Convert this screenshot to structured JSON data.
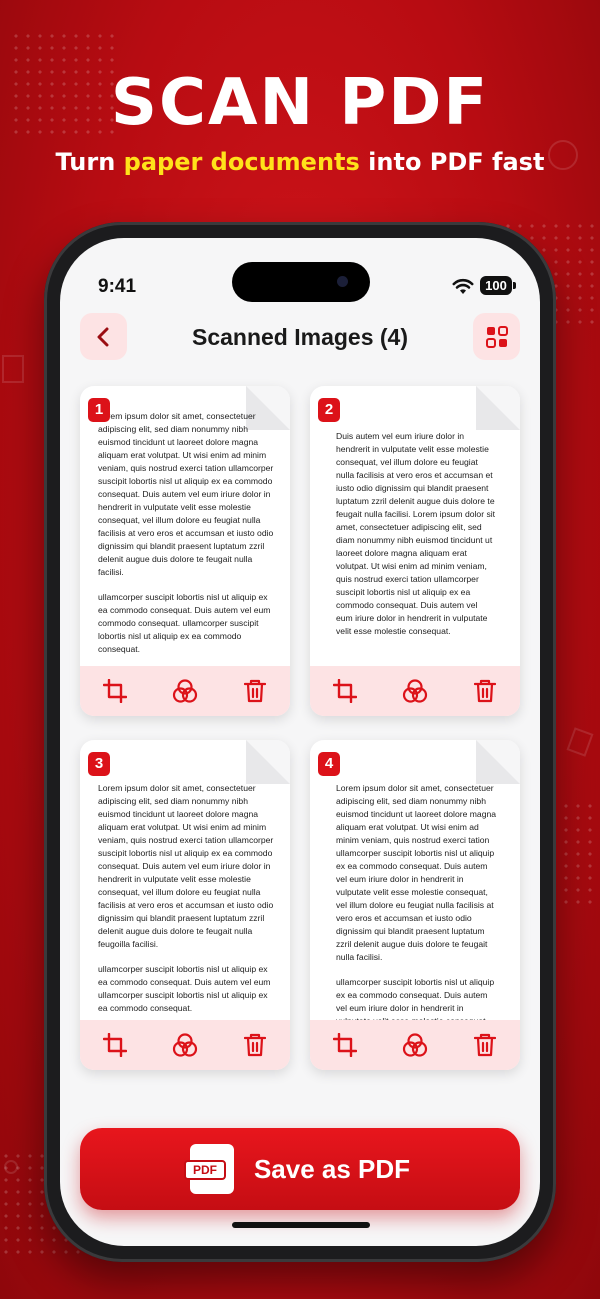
{
  "hero": {
    "title": "SCAN PDF",
    "subtitle_pre": "Turn ",
    "subtitle_highlight": "paper documents",
    "subtitle_post": " into PDF fast"
  },
  "status_bar": {
    "time": "9:41",
    "battery": "100"
  },
  "header": {
    "title": "Scanned Images (4)"
  },
  "cards": [
    {
      "number": "1",
      "paragraphs": [
        "Lorem ipsum dolor sit amet, consectetuer adipiscing elit, sed diam nonummy nibh euismod tincidunt ut laoreet dolore magna aliquam erat volutpat. Ut wisi enim ad minim veniam, quis nostrud exerci tation ullamcorper suscipit lobortis nisl ut aliquip ex ea commodo consequat. Duis autem vel eum iriure dolor in hendrerit in vulputate velit esse molestie consequat, vel illum dolore eu feugiat nulla facilisis at vero eros et accumsan et iusto odio dignissim qui blandit praesent luptatum zzril delenit augue duis dolore te feugait nulla facilisi.",
        "ullamcorper suscipit lobortis nisl ut aliquip ex ea commodo consequat. Duis autem vel eum commodo consequat. ullamcorper suscipit lobortis nisl ut aliquip ex ea commodo consequat."
      ]
    },
    {
      "number": "2",
      "paragraphs": [
        "Duis autem vel eum iriure dolor in hendrerit in vulputate velit esse molestie consequat, vel illum dolore eu feugiat nulla facilisis at vero eros et accumsan et iusto odio dignissim qui blandit praesent luptatum zzril delenit augue duis dolore te feugait nulla facilisi. Lorem ipsum dolor sit amet, consectetuer adipiscing elit, sed diam nonummy nibh euismod tincidunt ut laoreet dolore magna aliquam erat volutpat. Ut wisi enim ad minim veniam, quis nostrud exerci tation ullamcorper suscipit lobortis nisl ut aliquip ex ea commodo consequat. Duis autem vel eum iriure dolor in hendrerit in vulputate velit esse molestie consequat."
      ]
    },
    {
      "number": "3",
      "paragraphs": [
        "Lorem ipsum dolor sit amet, consectetuer adipiscing elit, sed diam nonummy nibh euismod tincidunt ut laoreet dolore magna aliquam erat volutpat. Ut wisi enim ad minim veniam, quis nostrud exerci tation ullamcorper suscipit lobortis nisl ut aliquip ex ea commodo consequat. Duis autem vel eum iriure dolor in hendrerit in vulputate velit esse molestie consequat, vel illum dolore eu feugiat nulla facilisis at vero eros et accumsan et iusto odio dignissim qui blandit praesent luptatum zzril delenit augue duis dolore te feugait nulla feugoilla facilisi.",
        "ullamcorper suscipit lobortis nisl ut aliquip ex ea commodo consequat. Duis autem vel eum ullamcorper suscipit lobortis nisl ut aliquip ex ea commodo consequat."
      ]
    },
    {
      "number": "4",
      "paragraphs": [
        "Lorem ipsum dolor sit amet, consectetuer adipiscing elit, sed diam nonummy nibh euismod tincidunt ut laoreet dolore magna aliquam erat volutpat. Ut wisi enim ad minim veniam, quis nostrud exerci tation ullamcorper suscipit lobortis nisl ut aliquip ex ea commodo consequat. Duis autem vel eum iriure dolor in hendrerit in vulputate velit esse molestie consequat, vel illum dolore eu feugiat nulla facilisis at vero eros et accumsan et iusto odio dignissim qui blandit praesent luptatum zzril delenit augue duis dolore te feugait nulla facilisi.",
        "ullamcorper suscipit lobortis nisl ut aliquip ex ea commodo consequat. Duis autem vel eum iriure dolor in hendrerit in vulputate velit esse molestie consequat."
      ]
    }
  ],
  "save_button": {
    "label": "Save as PDF",
    "icon_text": "PDF"
  },
  "icons": {
    "back": "chevron-left-icon",
    "grid": "grid-icon",
    "crop": "crop-icon",
    "filter": "filter-icon",
    "delete": "trash-icon"
  },
  "colors": {
    "brand_red": "#dc1219",
    "highlight_yellow": "#ffe21a",
    "action_bg": "#fde3e4"
  }
}
